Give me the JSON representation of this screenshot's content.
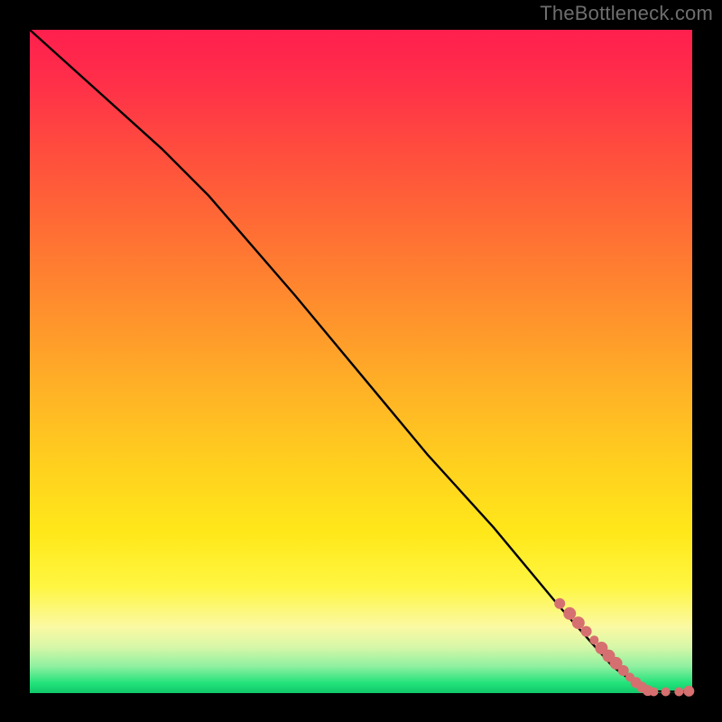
{
  "attribution": "TheBottleneck.com",
  "colors": {
    "frame": "#000000",
    "line": "#000000",
    "marker": "#d66f6f",
    "gradient_top": "#ff1f4e",
    "gradient_mid": "#ffe81a",
    "gradient_bottom": "#10c76a"
  },
  "chart_data": {
    "type": "line",
    "title": "",
    "xlabel": "",
    "ylabel": "",
    "xlim": [
      0,
      100
    ],
    "ylim": [
      0,
      100
    ],
    "grid": false,
    "legend": false,
    "series": [
      {
        "name": "curve",
        "x": [
          0,
          10,
          20,
          27,
          40,
          50,
          60,
          70,
          80,
          88,
          92,
          94,
          96,
          98,
          100
        ],
        "y": [
          100,
          91,
          82,
          75,
          60,
          48,
          36,
          25,
          13,
          4,
          1,
          0.3,
          0.2,
          0.2,
          0.3
        ]
      }
    ],
    "markers": {
      "name": "highlighted-points",
      "color": "#d66f6f",
      "points": [
        {
          "x": 80.0,
          "y": 13.5,
          "r": 6
        },
        {
          "x": 81.5,
          "y": 12.0,
          "r": 7
        },
        {
          "x": 82.8,
          "y": 10.6,
          "r": 7
        },
        {
          "x": 84.0,
          "y": 9.3,
          "r": 6
        },
        {
          "x": 85.2,
          "y": 8.0,
          "r": 5
        },
        {
          "x": 86.3,
          "y": 6.8,
          "r": 7
        },
        {
          "x": 87.4,
          "y": 5.6,
          "r": 7
        },
        {
          "x": 88.5,
          "y": 4.5,
          "r": 7
        },
        {
          "x": 89.6,
          "y": 3.4,
          "r": 6
        },
        {
          "x": 90.6,
          "y": 2.4,
          "r": 5
        },
        {
          "x": 91.5,
          "y": 1.6,
          "r": 6
        },
        {
          "x": 92.4,
          "y": 0.9,
          "r": 6
        },
        {
          "x": 93.3,
          "y": 0.4,
          "r": 6
        },
        {
          "x": 94.2,
          "y": 0.2,
          "r": 5
        },
        {
          "x": 96.0,
          "y": 0.2,
          "r": 5
        },
        {
          "x": 98.0,
          "y": 0.2,
          "r": 5
        },
        {
          "x": 99.5,
          "y": 0.3,
          "r": 6
        }
      ]
    }
  }
}
